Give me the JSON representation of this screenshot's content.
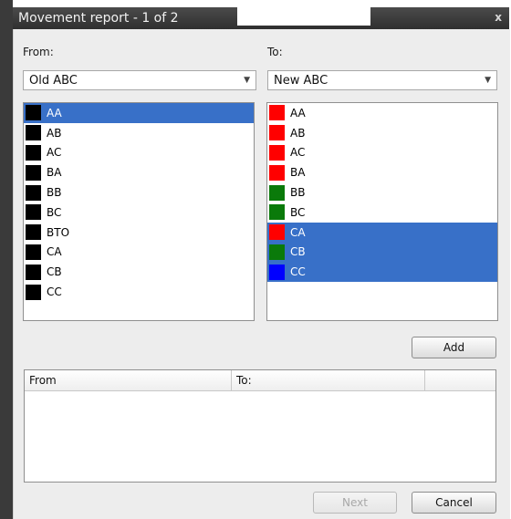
{
  "window": {
    "title": "Movement report - 1 of 2",
    "close_glyph": "x"
  },
  "from": {
    "label": "From:",
    "selected": "Old ABC",
    "items": [
      {
        "label": "AA",
        "color": "#000000",
        "selected": true
      },
      {
        "label": "AB",
        "color": "#000000",
        "selected": false
      },
      {
        "label": "AC",
        "color": "#000000",
        "selected": false
      },
      {
        "label": "BA",
        "color": "#000000",
        "selected": false
      },
      {
        "label": "BB",
        "color": "#000000",
        "selected": false
      },
      {
        "label": "BC",
        "color": "#000000",
        "selected": false
      },
      {
        "label": "BTO",
        "color": "#000000",
        "selected": false
      },
      {
        "label": "CA",
        "color": "#000000",
        "selected": false
      },
      {
        "label": "CB",
        "color": "#000000",
        "selected": false
      },
      {
        "label": "CC",
        "color": "#000000",
        "selected": false
      }
    ]
  },
  "to": {
    "label": "To:",
    "selected": "New ABC",
    "items": [
      {
        "label": "AA",
        "color": "#ff0000",
        "selected": false
      },
      {
        "label": "AB",
        "color": "#ff0000",
        "selected": false
      },
      {
        "label": "AC",
        "color": "#ff0000",
        "selected": false
      },
      {
        "label": "BA",
        "color": "#ff0000",
        "selected": false
      },
      {
        "label": "BB",
        "color": "#0a7a0a",
        "selected": false
      },
      {
        "label": "BC",
        "color": "#0a7a0a",
        "selected": false
      },
      {
        "label": "CA",
        "color": "#ff0000",
        "selected": true
      },
      {
        "label": "CB",
        "color": "#0a7a0a",
        "selected": true
      },
      {
        "label": "CC",
        "color": "#0000ff",
        "selected": true
      }
    ]
  },
  "buttons": {
    "add": "Add",
    "next": "Next",
    "cancel": "Cancel"
  },
  "mapping_table": {
    "columns": [
      "From",
      "To:",
      ""
    ]
  },
  "colors": {
    "selection": "#3870c8",
    "titlebar": "#3a3a3a"
  }
}
